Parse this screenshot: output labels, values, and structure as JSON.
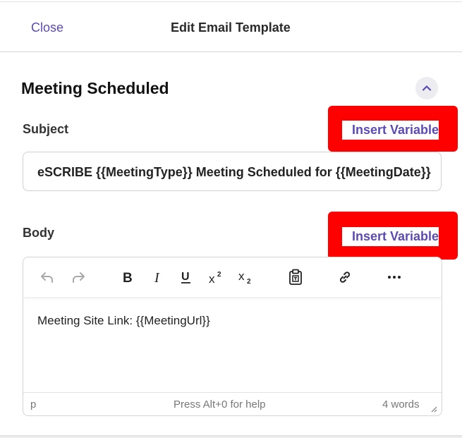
{
  "header": {
    "close_label": "Close",
    "title": "Edit Email Template"
  },
  "section": {
    "title": "Meeting Scheduled",
    "collapse_icon": "chevron-up-icon"
  },
  "subject": {
    "label": "Subject",
    "insert_variable_label": "Insert Variable",
    "value": "eSCRIBE {{MeetingType}} Meeting Scheduled for {{MeetingDate}}"
  },
  "body": {
    "label": "Body",
    "insert_variable_label": "Insert Variable",
    "content": "Meeting Site Link: {{MeetingUrl}}"
  },
  "toolbar": {
    "icons": [
      "undo-icon",
      "redo-icon",
      "bold-icon",
      "italic-icon",
      "underline-icon",
      "superscript-icon",
      "subscript-icon",
      "paste-text-icon",
      "link-icon",
      "more-icon"
    ]
  },
  "statusbar": {
    "path": "p",
    "help": "Press Alt+0 for help",
    "words": "4 words"
  },
  "colors": {
    "accent": "#5c4bb5",
    "highlight": "#ff0000"
  }
}
